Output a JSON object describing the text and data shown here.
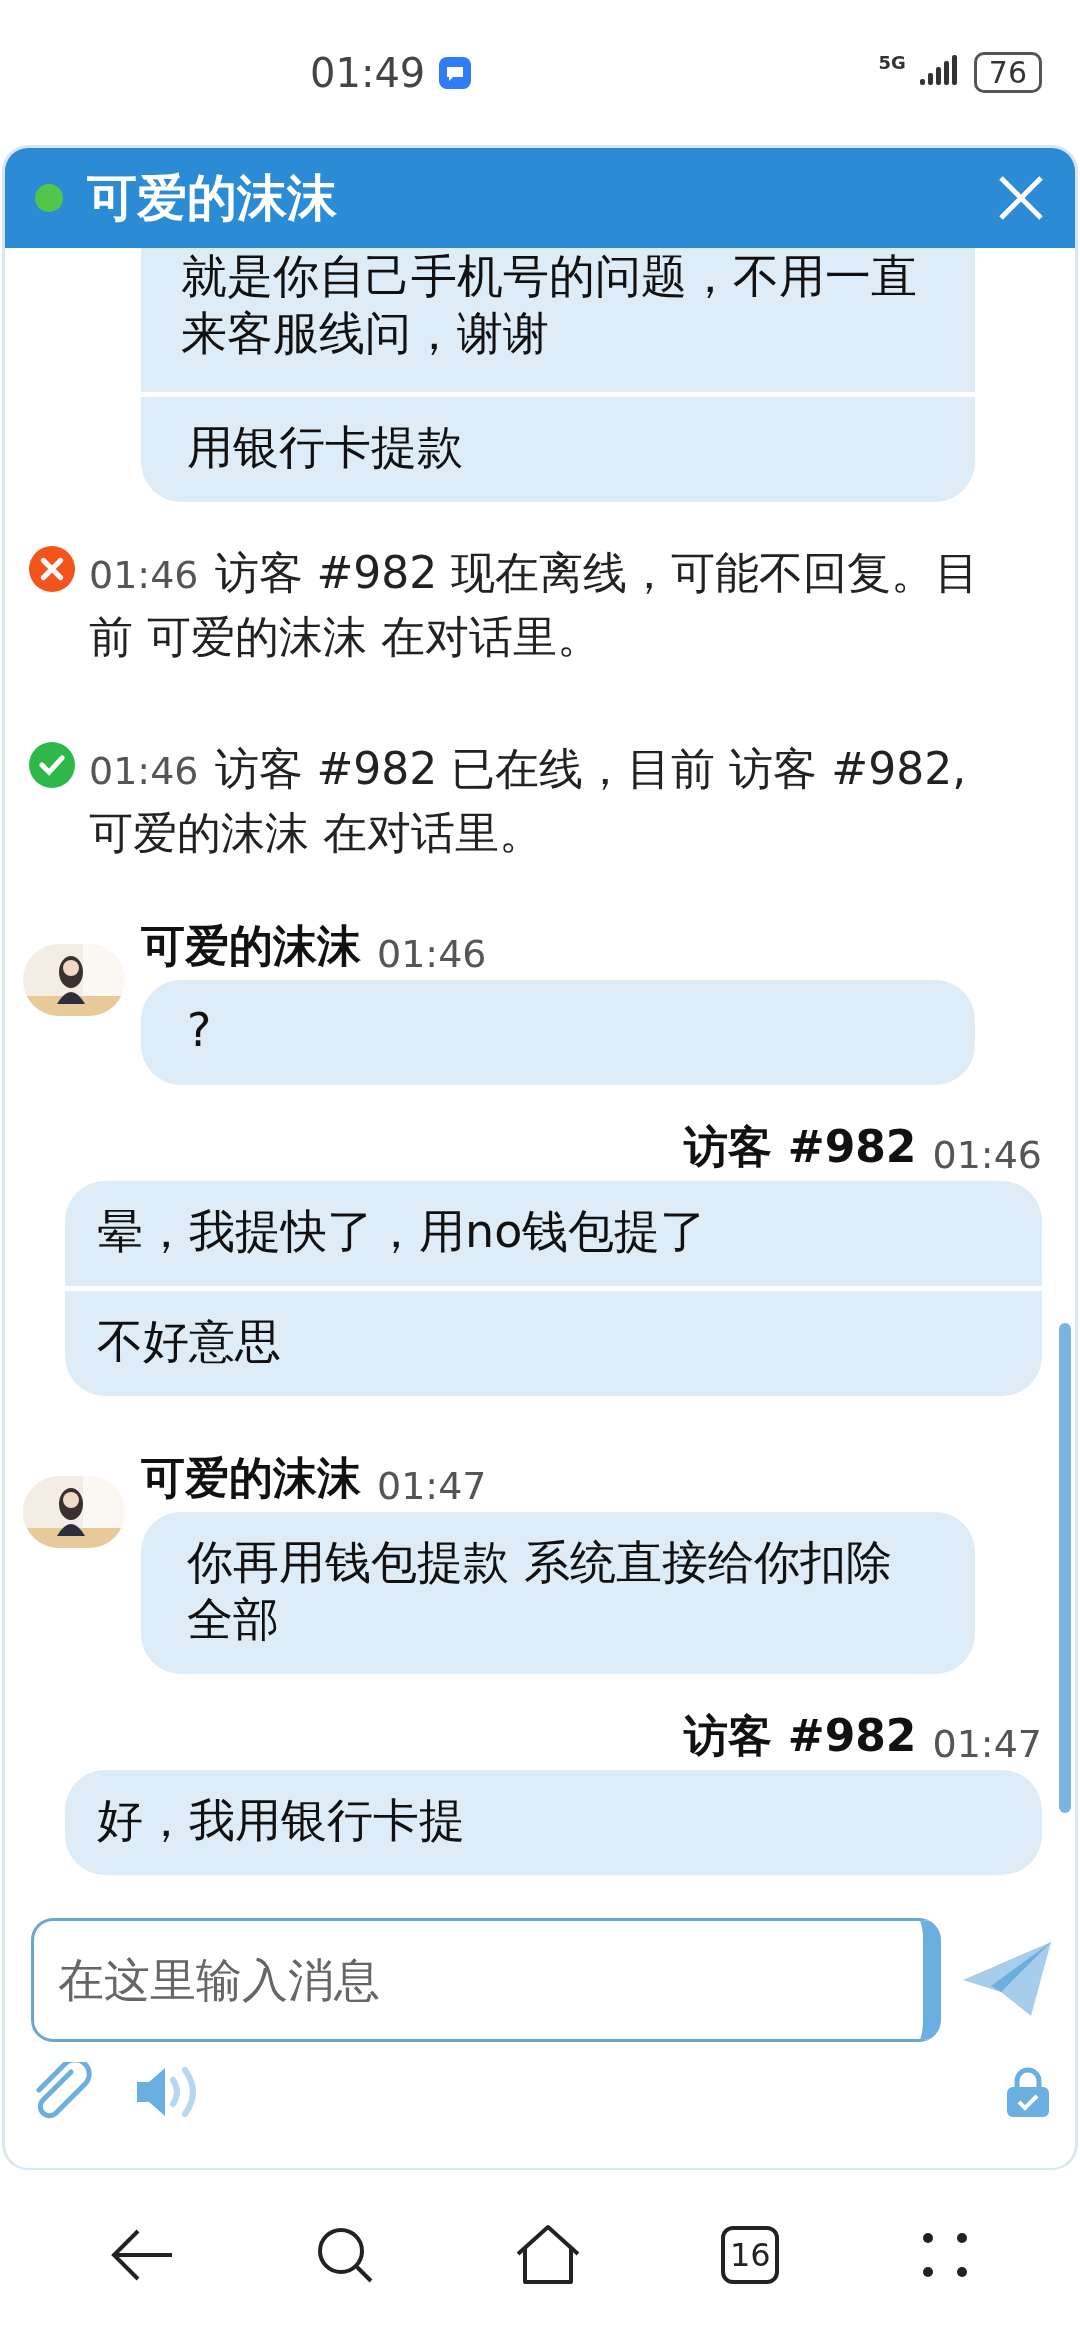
{
  "status_bar": {
    "time": "01:49",
    "network": "5G",
    "battery": "76"
  },
  "header": {
    "title": "可爱的沫沫",
    "online": true
  },
  "messages": [
    {
      "kind": "continued",
      "from_visitor": false,
      "bubbles": [
        "就是你自己手机号的问题，不用一直来客服线问，谢谢",
        "用银行卡提款"
      ]
    },
    {
      "kind": "system",
      "online": false,
      "time": "01:46",
      "text": "访客 #982 现在离线，可能不回复。目前 可爱的沫沫 在对话里。"
    },
    {
      "kind": "system",
      "online": true,
      "time": "01:46",
      "text": "访客 #982 已在线，目前 访客 #982, 可爱的沫沫 在对话里。"
    },
    {
      "kind": "message",
      "from_visitor": false,
      "sender": "可爱的沫沫",
      "time": "01:46",
      "bubbles": [
        "?"
      ]
    },
    {
      "kind": "message",
      "from_visitor": true,
      "sender": "访客 #982",
      "time": "01:46",
      "bubbles": [
        "晕，我提快了，用no钱包提了",
        "不好意思"
      ]
    },
    {
      "kind": "message",
      "from_visitor": false,
      "sender": "可爱的沫沫",
      "time": "01:47",
      "bubbles": [
        "你再用钱包提款 系统直接给你扣除全部"
      ]
    },
    {
      "kind": "message",
      "from_visitor": true,
      "sender": "访客 #982",
      "time": "01:47",
      "bubbles": [
        "好，我用银行卡提"
      ]
    }
  ],
  "composer": {
    "placeholder": "在这里输入消息"
  },
  "nav_bar": {
    "tabs_count": "16"
  }
}
